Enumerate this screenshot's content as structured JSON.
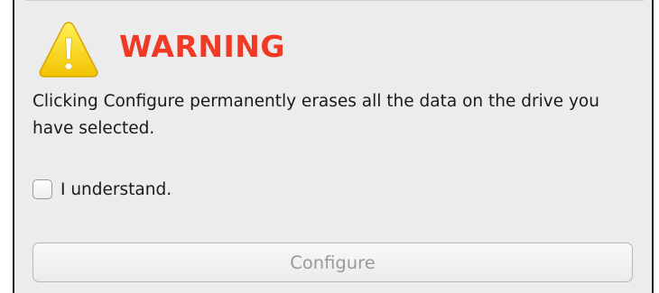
{
  "warning": {
    "icon": "warning-triangle-icon",
    "title": "WARNING",
    "title_color": "#f03a24",
    "message": "Clicking Configure permanently erases all the data on the drive you have selected."
  },
  "confirm": {
    "checked": false,
    "label": "I understand."
  },
  "configure_button": {
    "label": "Configure",
    "enabled": false
  }
}
